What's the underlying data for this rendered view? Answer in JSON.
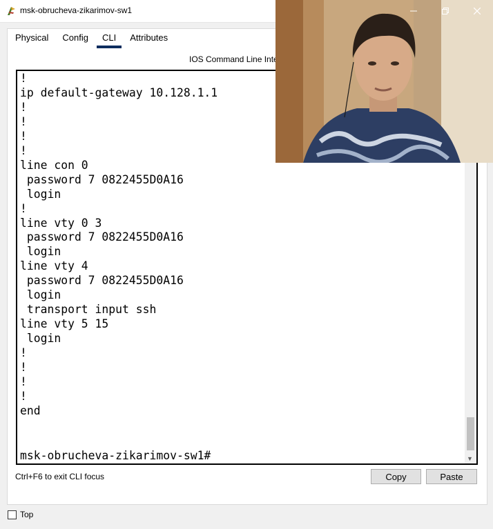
{
  "window": {
    "title": "msk-obrucheva-zikarimov-sw1",
    "app_icon": "packet-tracer-icon",
    "controls": [
      "minimize-icon",
      "restore-icon",
      "close-icon"
    ]
  },
  "tabs": [
    {
      "label": "Physical",
      "active": false
    },
    {
      "label": "Config",
      "active": false
    },
    {
      "label": "CLI",
      "active": true
    },
    {
      "label": "Attributes",
      "active": false
    }
  ],
  "cli": {
    "title": "IOS Command Line Interface",
    "output": "!\nip default-gateway 10.128.1.1\n!\n!\n!\n!\nline con 0\n password 7 0822455D0A16\n login\n!\nline vty 0 3\n password 7 0822455D0A16\n login\nline vty 4\n password 7 0822455D0A16\n login\n transport input ssh\nline vty 5 15\n login\n!\n!\n!\n!\nend",
    "prompt": "msk-obrucheva-zikarimov-sw1#"
  },
  "footer": {
    "hint": "Ctrl+F6 to exit CLI focus",
    "copy_label": "Copy",
    "paste_label": "Paste"
  },
  "top_checkbox": {
    "label": "Top",
    "checked": false
  },
  "colors": {
    "tab_underline": "#0d2d5e",
    "console_border": "#000000",
    "button_bg": "#e1e1e1"
  }
}
